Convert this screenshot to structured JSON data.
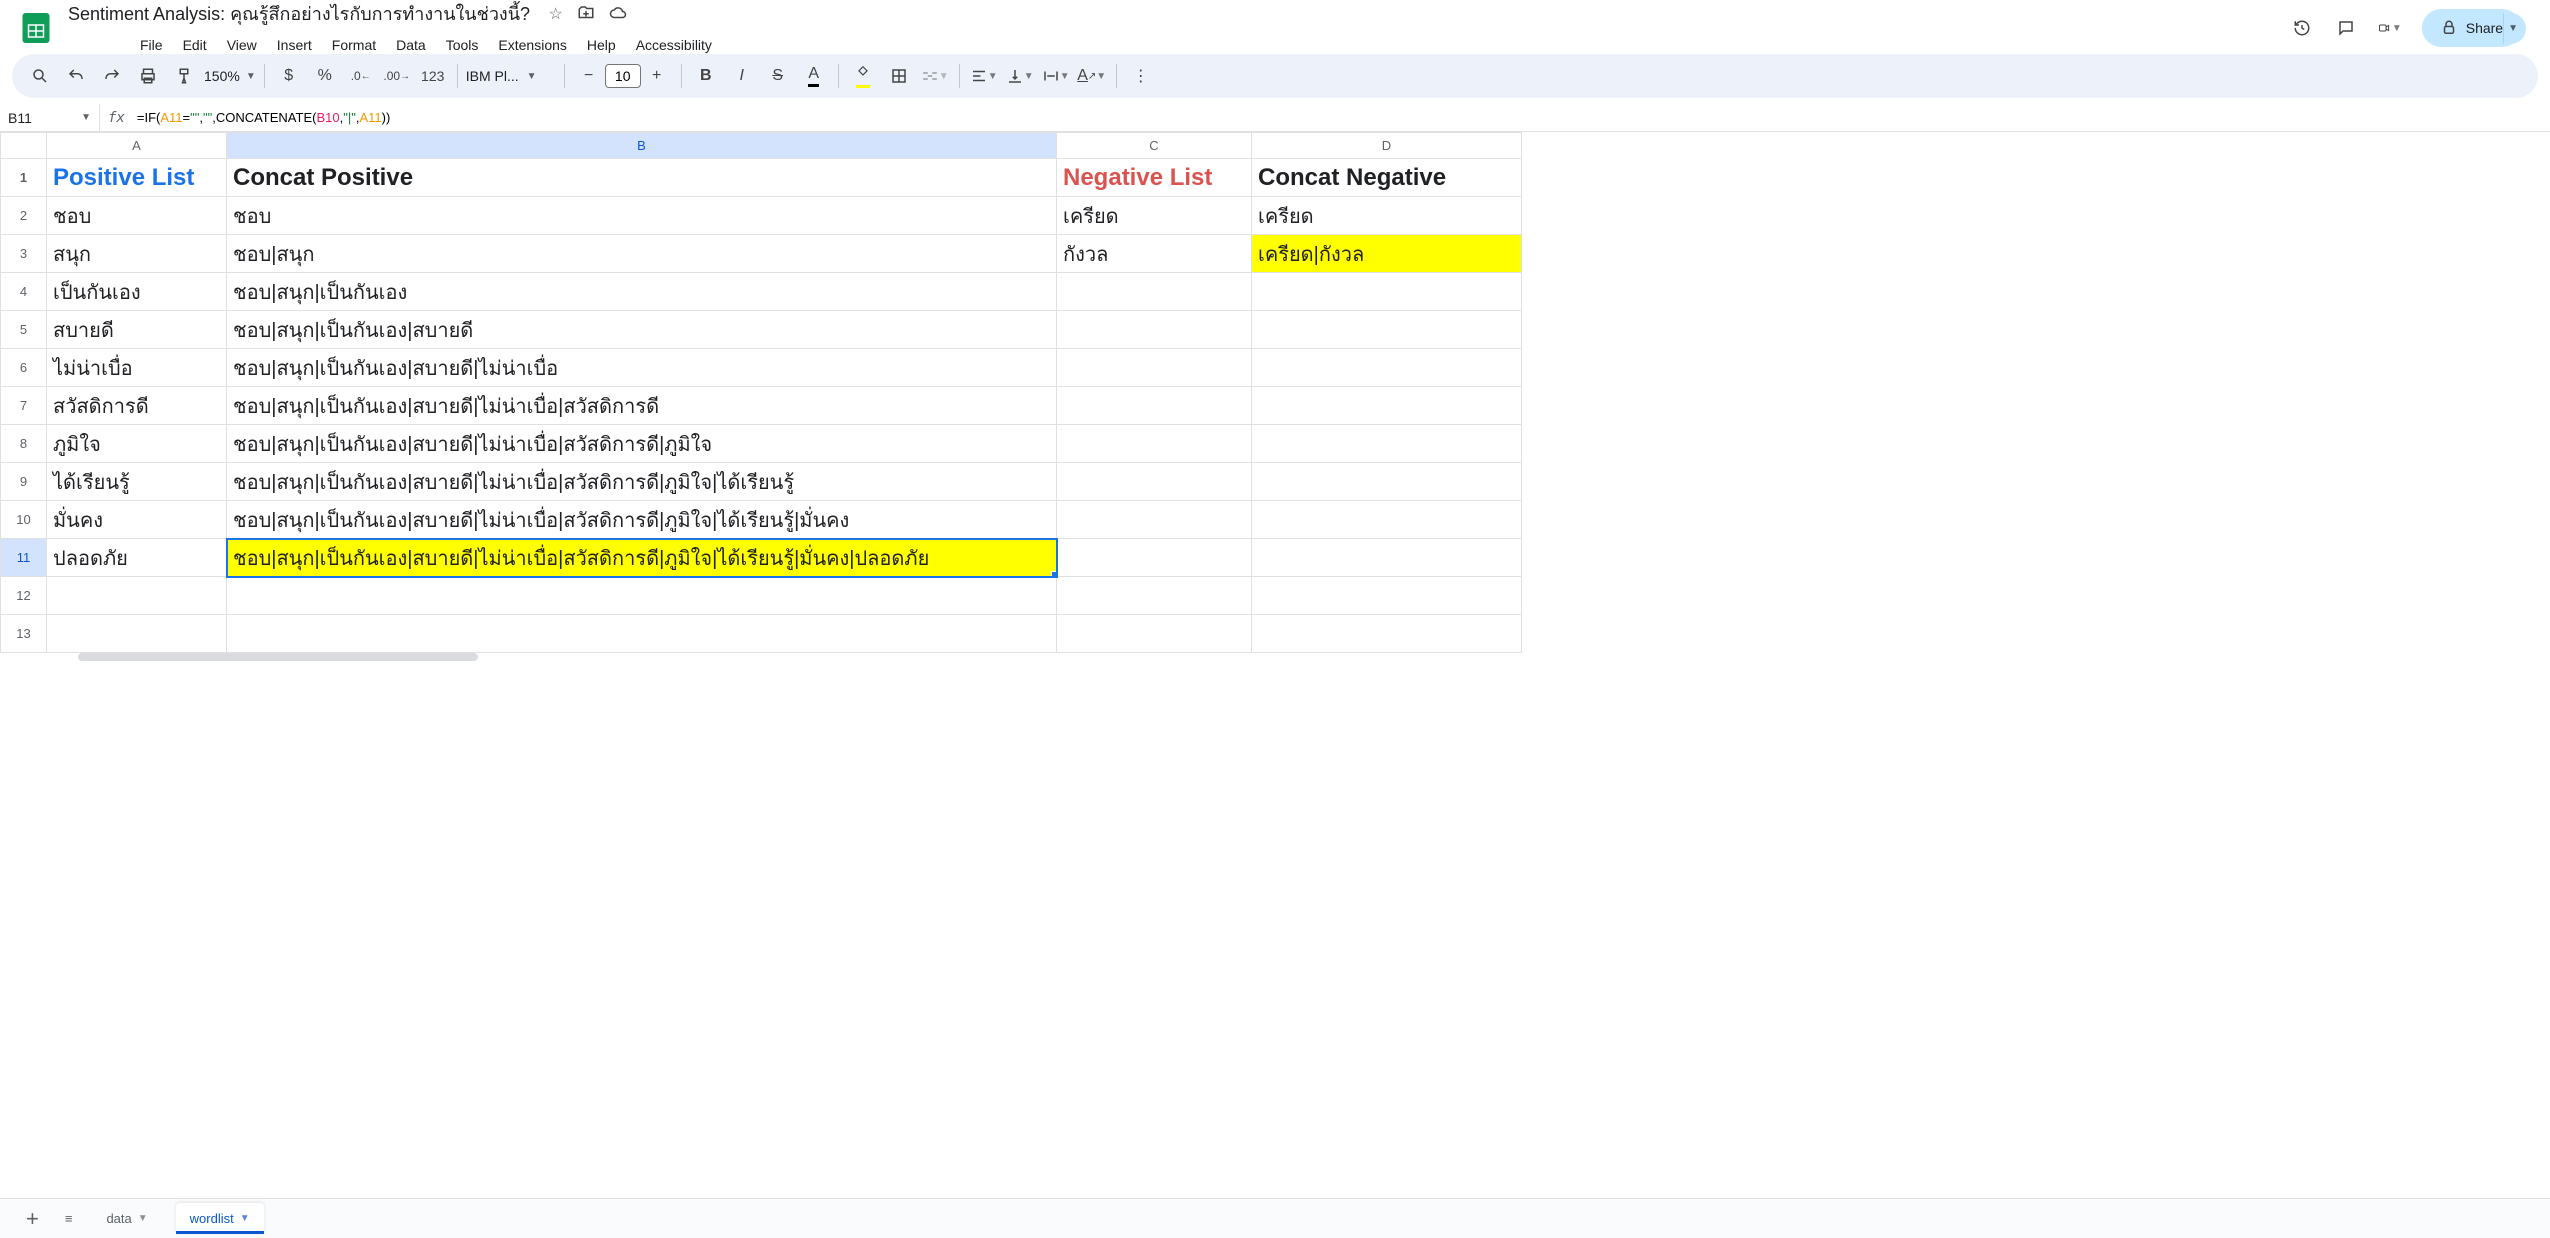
{
  "doc": {
    "title": "Sentiment Analysis: คุณรู้สึกอย่างไรกับการทำงานในช่วงนี้?"
  },
  "menu": {
    "file": "File",
    "edit": "Edit",
    "view": "View",
    "insert": "Insert",
    "format": "Format",
    "data": "Data",
    "tools": "Tools",
    "extensions": "Extensions",
    "help": "Help",
    "accessibility": "Accessibility"
  },
  "toolbar": {
    "zoom": "150%",
    "currency": "$",
    "percent": "%",
    "dec_dec": ".0",
    "dec_inc": ".00",
    "num123": "123",
    "font": "IBM Pl...",
    "size": "10"
  },
  "share": {
    "label": "Share"
  },
  "namebox": "B11",
  "formula": {
    "prefix": "=IF(",
    "a1": "A11",
    "mid1": "=",
    "s1": "\"\"",
    "mid2": ",",
    "s2": "\"\"",
    "mid3": ",CONCATENATE(",
    "b1": "B10",
    "mid4": ",",
    "s3": "\"|\"",
    "mid5": ",",
    "a2": "A11",
    "suffix": "))"
  },
  "cols": [
    "A",
    "B",
    "C",
    "D"
  ],
  "headers": {
    "A": "Positive List",
    "B": "Concat Positive",
    "C": "Negative List",
    "D": "Concat Negative"
  },
  "rows": [
    {
      "n": "2",
      "A": "ชอบ",
      "B": "ชอบ",
      "C": "เครียด",
      "D": "เครียด"
    },
    {
      "n": "3",
      "A": "สนุก",
      "B": "ชอบ|สนุก",
      "C": "กังวล",
      "D": "เครียด|กังวล",
      "D_hl": true
    },
    {
      "n": "4",
      "A": "เป็นกันเอง",
      "B": "ชอบ|สนุก|เป็นกันเอง",
      "C": "",
      "D": ""
    },
    {
      "n": "5",
      "A": "สบายดี",
      "B": "ชอบ|สนุก|เป็นกันเอง|สบายดี",
      "C": "",
      "D": ""
    },
    {
      "n": "6",
      "A": "ไม่น่าเบื่อ",
      "B": "ชอบ|สนุก|เป็นกันเอง|สบายดี|ไม่น่าเบื่อ",
      "C": "",
      "D": ""
    },
    {
      "n": "7",
      "A": "สวัสดิการดี",
      "B": "ชอบ|สนุก|เป็นกันเอง|สบายดี|ไม่น่าเบื่อ|สวัสดิการดี",
      "C": "",
      "D": ""
    },
    {
      "n": "8",
      "A": "ภูมิใจ",
      "B": "ชอบ|สนุก|เป็นกันเอง|สบายดี|ไม่น่าเบื่อ|สวัสดิการดี|ภูมิใจ",
      "C": "",
      "D": ""
    },
    {
      "n": "9",
      "A": "ได้เรียนรู้",
      "B": "ชอบ|สนุก|เป็นกันเอง|สบายดี|ไม่น่าเบื่อ|สวัสดิการดี|ภูมิใจ|ได้เรียนรู้",
      "C": "",
      "D": ""
    },
    {
      "n": "10",
      "A": "มั่นคง",
      "B": "ชอบ|สนุก|เป็นกันเอง|สบายดี|ไม่น่าเบื่อ|สวัสดิการดี|ภูมิใจ|ได้เรียนรู้|มั่นคง",
      "C": "",
      "D": ""
    },
    {
      "n": "11",
      "A": "ปลอดภัย",
      "B": "ชอบ|สนุก|เป็นกันเอง|สบายดี|ไม่น่าเบื่อ|สวัสดิการดี|ภูมิใจ|ได้เรียนรู้|มั่นคง|ปลอดภัย",
      "B_sel": true,
      "C": "",
      "D": ""
    },
    {
      "n": "12",
      "A": "",
      "B": "",
      "C": "",
      "D": ""
    },
    {
      "n": "13",
      "A": "",
      "B": "",
      "C": "",
      "D": ""
    }
  ],
  "tabs": {
    "t1": "data",
    "t2": "wordlist"
  }
}
